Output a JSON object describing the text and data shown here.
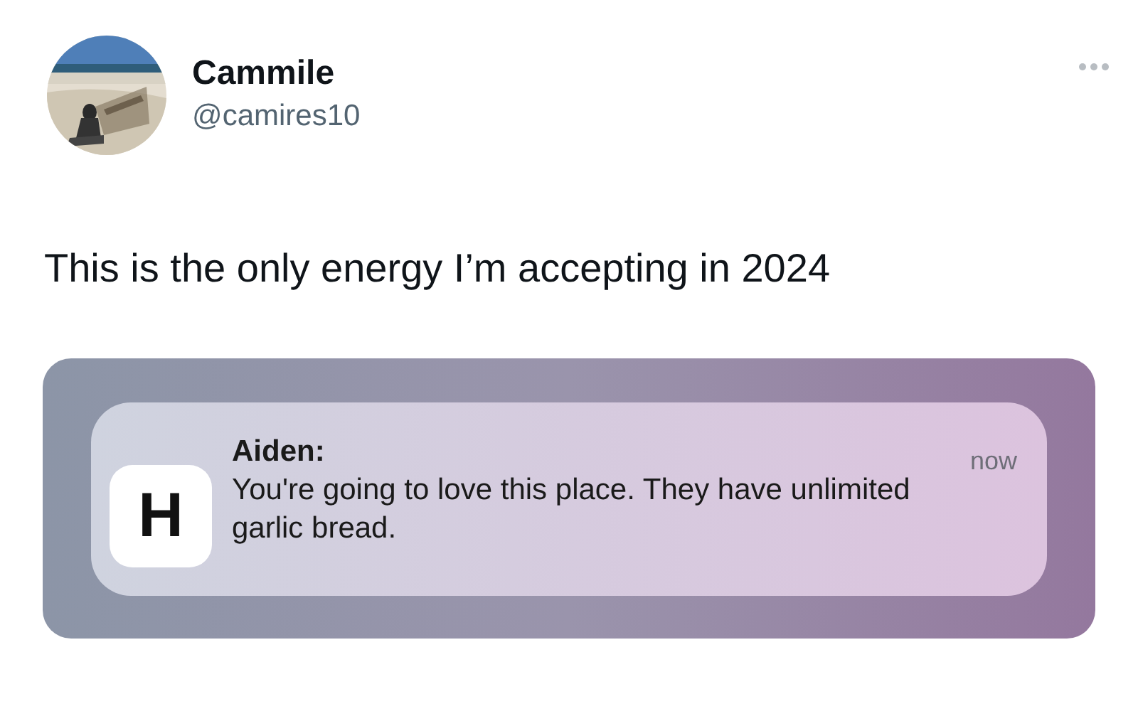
{
  "author": {
    "name": "Cammile",
    "handle": "@camires10"
  },
  "tweet_text": "This is the only energy I’m accepting in 2024",
  "notification": {
    "app_icon_letter": "H",
    "sender": "Aiden:",
    "time": "now",
    "message": "You're going to love this place. They have unlimited garlic bread."
  }
}
